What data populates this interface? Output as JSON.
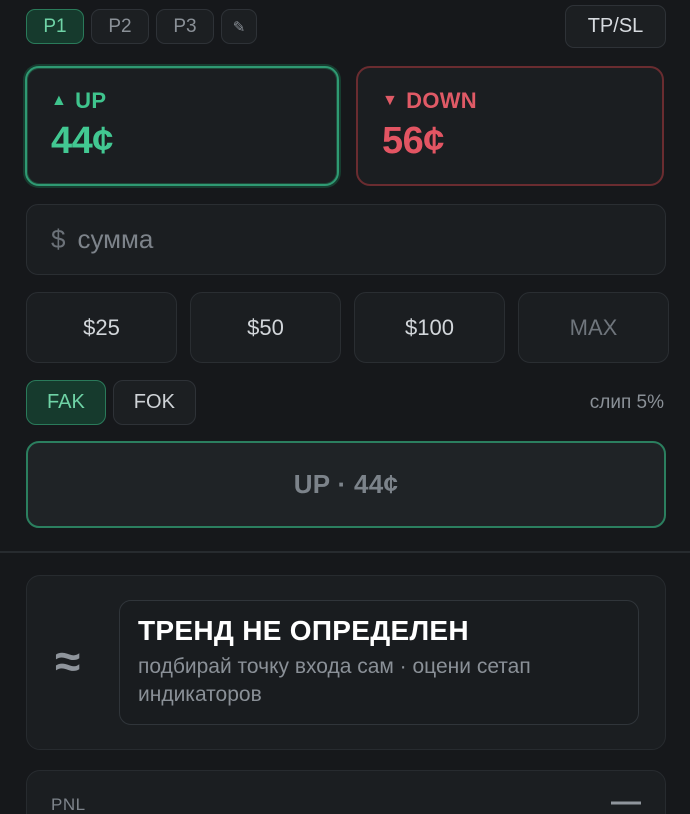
{
  "presets": {
    "items": [
      "P1",
      "P2",
      "P3"
    ],
    "active": "P1",
    "edit_icon": "✎"
  },
  "tpsl_label": "TP/SL",
  "up": {
    "arrow": "▲",
    "label": "UP",
    "price": "44¢",
    "color": "#3fc48d"
  },
  "down": {
    "arrow": "▼",
    "label": "DOWN",
    "price": "56¢",
    "color": "#e05a66"
  },
  "amount": {
    "currency": "$",
    "placeholder": "сумма",
    "value": ""
  },
  "quick_amounts": [
    "$25",
    "$50",
    "$100",
    "MAX"
  ],
  "order_types": {
    "items": [
      "FAK",
      "FOK"
    ],
    "active": "FAK"
  },
  "slippage": "слип 5%",
  "submit_label": "UP · 44¢",
  "trend": {
    "icon": "≈",
    "title": "ТРЕНД НЕ ОПРЕДЕЛЕН",
    "subtitle": "подбирай точку входа сам · оцени сетап индикаторов"
  },
  "pnl": {
    "label": "PNL",
    "value": "—"
  }
}
